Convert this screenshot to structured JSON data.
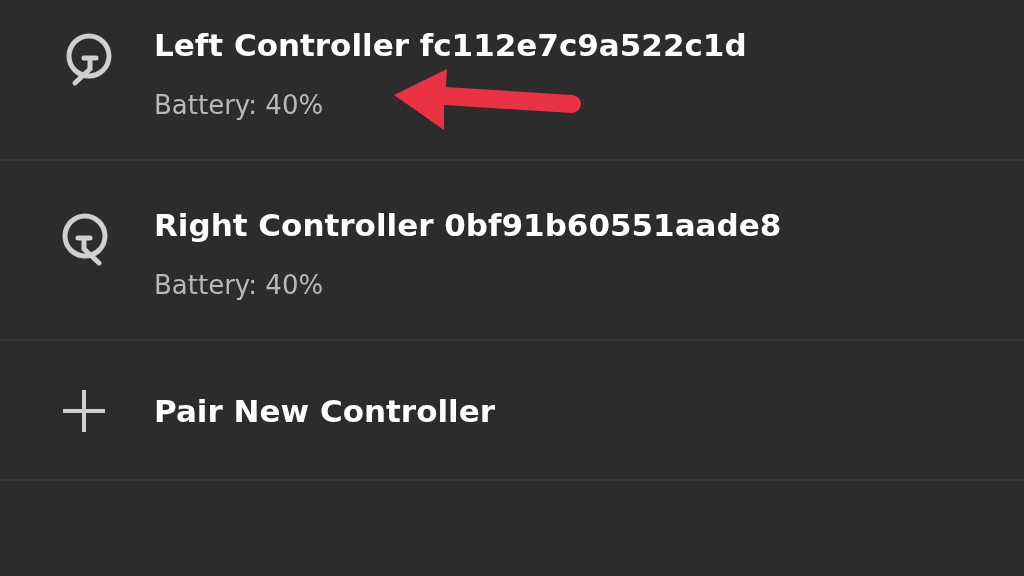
{
  "controllers": [
    {
      "kind": "left",
      "name": "Left Controller fc112e7c9a522c1d",
      "battery": "Battery: 40%"
    },
    {
      "kind": "right",
      "name": "Right Controller 0bf91b60551aade8",
      "battery": "Battery: 40%"
    }
  ],
  "pair_action": {
    "label": "Pair New Controller"
  }
}
